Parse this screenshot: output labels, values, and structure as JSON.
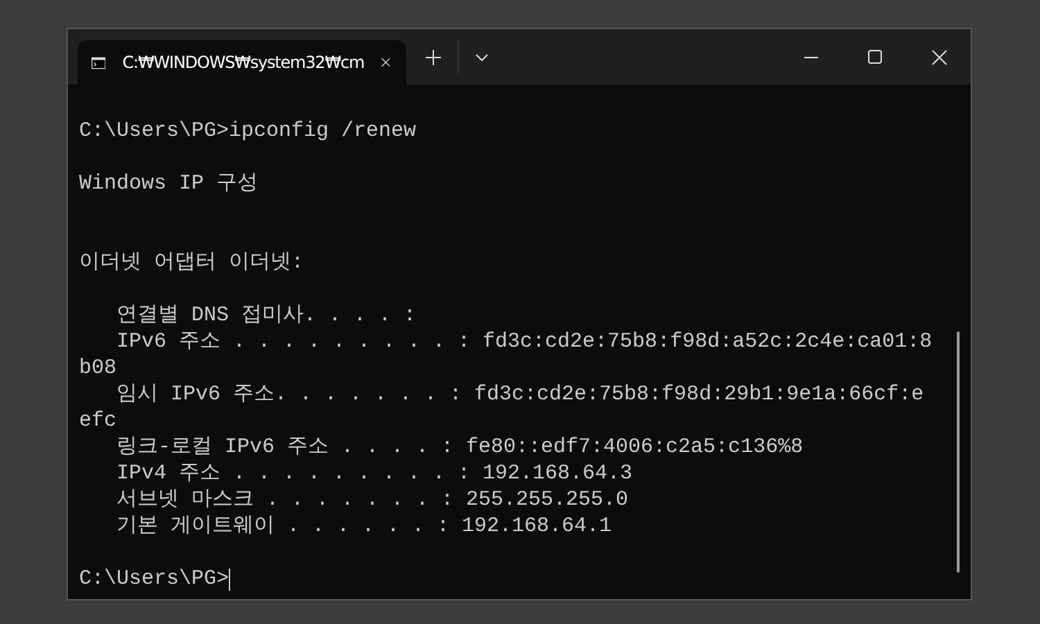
{
  "window": {
    "tab_title": "C:₩WINDOWS₩system32₩cm"
  },
  "terminal": {
    "lines": [
      {
        "kind": "text",
        "text": "C:\\Users\\PG>ipconfig /renew"
      },
      {
        "kind": "blank"
      },
      {
        "kind": "text",
        "text": "Windows IP 구성"
      },
      {
        "kind": "blank"
      },
      {
        "kind": "blank"
      },
      {
        "kind": "text",
        "text": "이더넷 어댑터 이더넷:"
      },
      {
        "kind": "blank"
      },
      {
        "kind": "text",
        "text": "   연결별 DNS 접미사. . . . :"
      },
      {
        "kind": "text",
        "text": "   IPv6 주소 . . . . . . . . . : fd3c:cd2e:75b8:f98d:a52c:2c4e:ca01:8"
      },
      {
        "kind": "text",
        "text": "b08"
      },
      {
        "kind": "text",
        "text": "   임시 IPv6 주소. . . . . . . : fd3c:cd2e:75b8:f98d:29b1:9e1a:66cf:e"
      },
      {
        "kind": "text",
        "text": "efc"
      },
      {
        "kind": "text",
        "text": "   링크-로컬 IPv6 주소 . . . . : fe80::edf7:4006:c2a5:c136%8"
      },
      {
        "kind": "text",
        "text": "   IPv4 주소 . . . . . . . . . : 192.168.64.3"
      },
      {
        "kind": "text",
        "text": "   서브넷 마스크 . . . . . . . : 255.255.255.0"
      },
      {
        "kind": "text",
        "text": "   기본 게이트웨이 . . . . . . : 192.168.64.1"
      },
      {
        "kind": "blank"
      },
      {
        "kind": "prompt",
        "text": "C:\\Users\\PG>"
      }
    ]
  }
}
